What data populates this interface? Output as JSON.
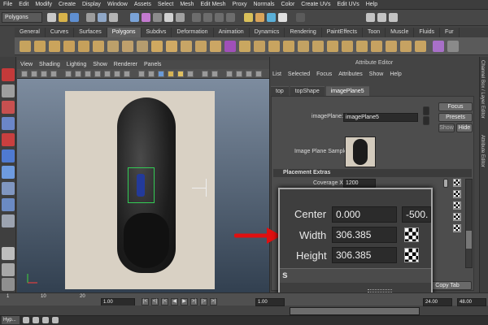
{
  "menubar": {
    "items": [
      "File",
      "Edit",
      "Modify",
      "Create",
      "Display",
      "Window",
      "Assets",
      "Select",
      "Mesh",
      "Edit Mesh",
      "Proxy",
      "Normals",
      "Color",
      "Create UVs",
      "Edit UVs",
      "Help"
    ]
  },
  "status_line": {
    "mode": "Polygons"
  },
  "shelf": {
    "tabs": [
      "General",
      "Curves",
      "Surfaces",
      "Polygons",
      "Subdivs",
      "Deformation",
      "Animation",
      "Dynamics",
      "Rendering",
      "PaintEffects",
      "Toon",
      "Muscle",
      "Fluids",
      "Fur"
    ],
    "active_tab": "Polygons"
  },
  "viewport": {
    "menu": [
      "View",
      "Shading",
      "Lighting",
      "Show",
      "Renderer",
      "Panels"
    ]
  },
  "attribute_editor": {
    "title": "Attribute Editor",
    "menu": [
      "List",
      "Selected",
      "Focus",
      "Attributes",
      "Show",
      "Help"
    ],
    "tabs": [
      "top",
      "topShape",
      "imagePlane5"
    ],
    "active_tab": "imagePlane5",
    "node_label": "imagePlane:",
    "node_value": "imagePlane5",
    "buttons": {
      "focus": "Focus",
      "presets": "Presets",
      "show": "Show",
      "hide": "Hide",
      "copy_tab": "Copy Tab"
    },
    "sample_label": "Image Plane Sample",
    "section": "Placement Extras",
    "coverage_x_label": "Coverage X",
    "coverage_x_value": "1200"
  },
  "side_tabs": {
    "channel_box": "Channel Box / Layer Editor",
    "attribute_editor": "Attribute Editor"
  },
  "zoom_callout": {
    "center_label": "Center",
    "center_x": "0.000",
    "center_y": "-500.",
    "width_label": "Width",
    "width_value": "306.385",
    "height_label": "Height",
    "height_value": "306.385",
    "section_fragment": "s"
  },
  "time_slider": {
    "ticks": [
      "1",
      "10",
      "20"
    ],
    "current_frame": "1.00",
    "range_start": "1.00",
    "range_end": "24.00",
    "playback_end": "48.00"
  },
  "taskbar": {
    "item": "Hyp..."
  },
  "colors": {
    "accent_red": "#e01010",
    "selection_green": "#33cc55"
  }
}
